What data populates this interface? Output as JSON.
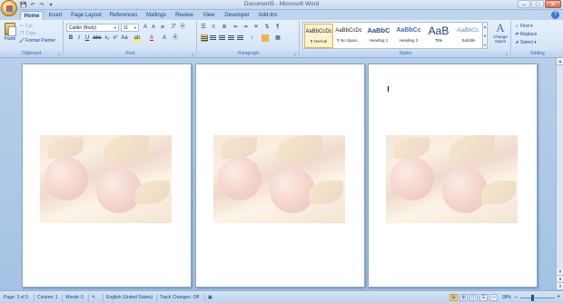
{
  "titlebar": {
    "title": "Document5 - Microsoft Word",
    "qat": [
      "💾",
      "↶",
      "↷",
      "▾"
    ],
    "controls": [
      "–",
      "□",
      "✕"
    ]
  },
  "tabs": [
    "Home",
    "Insert",
    "Page Layout",
    "References",
    "Mailings",
    "Review",
    "View",
    "Developer",
    "Add-Ins"
  ],
  "active_tab": "Home",
  "clipboard": {
    "paste_label": "Paste",
    "cut_label": "Cut",
    "copy_label": "Copy",
    "format_painter_label": "Format Painter",
    "group_label": "Clipboard"
  },
  "font": {
    "font_name": "Calibri (Body)",
    "font_size": "11",
    "group_label": "Font"
  },
  "paragraph": {
    "group_label": "Paragraph"
  },
  "styles": {
    "group_label": "Styles",
    "items": [
      {
        "sample": "AaBbCcDc",
        "name": "¶ Normal"
      },
      {
        "sample": "AaBbCcDc",
        "name": "¶ No Spaci..."
      },
      {
        "sample": "AaBbC",
        "name": "Heading 1"
      },
      {
        "sample": "AaBbCc",
        "name": "Heading 2"
      },
      {
        "sample": "AaB",
        "name": "Title"
      },
      {
        "sample": "AaBbCc.",
        "name": "Subtitle"
      }
    ],
    "change_styles_label": "Change Styles",
    "change_styles_glyph": "A"
  },
  "editing": {
    "group_label": "Editing",
    "find_label": "Find",
    "replace_label": "Replace",
    "select_label": "Select"
  },
  "statusbar": {
    "page": "Page: 3 of 3",
    "column": "Column: 1",
    "words": "Words: 0",
    "language": "English (United States)",
    "track_changes": "Track Changes: Off",
    "zoom": "38%",
    "zoom_minus": "–",
    "zoom_plus": "+"
  },
  "colors": {
    "ribbon": "#dbe8f7",
    "document_background": "#a5c2e4",
    "accent": "#15428b"
  }
}
